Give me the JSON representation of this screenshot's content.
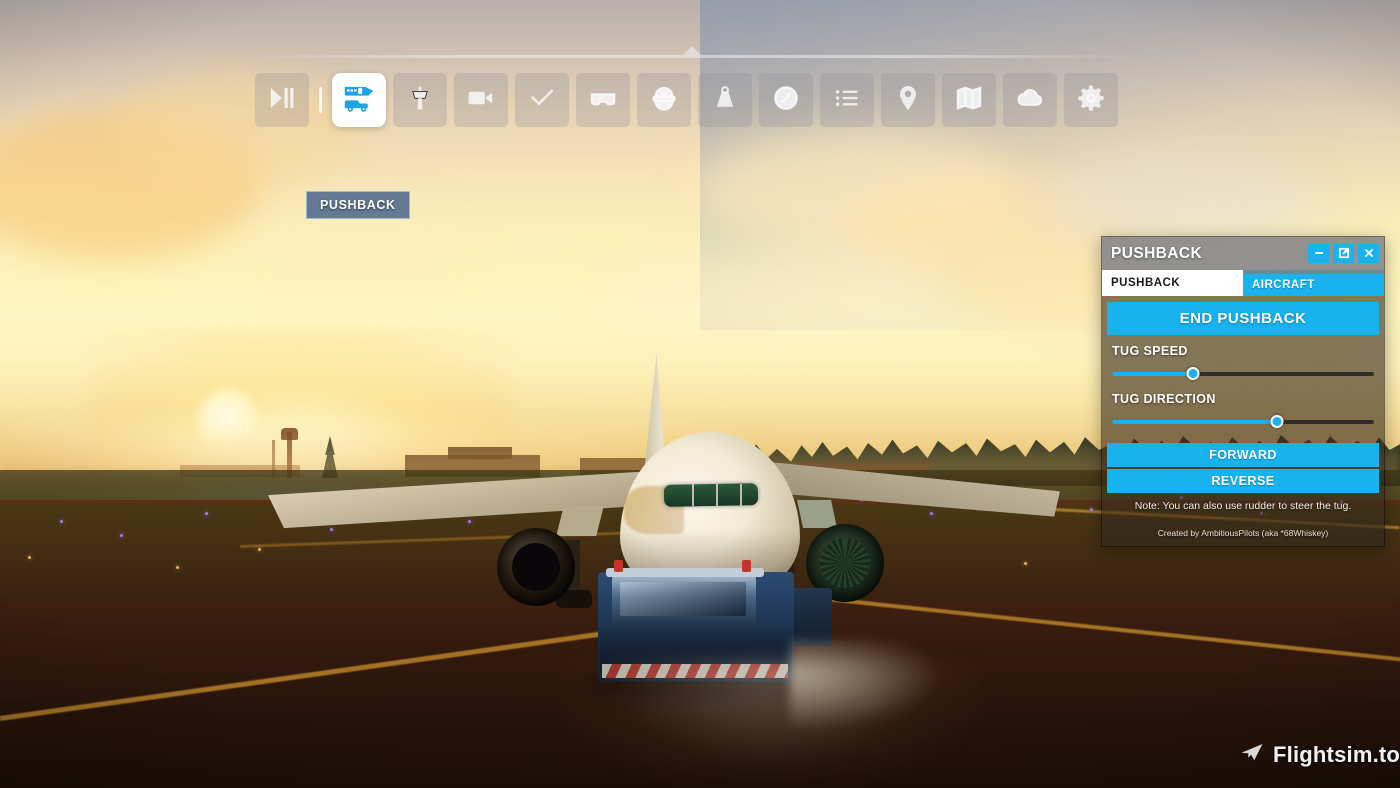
{
  "toolbar": {
    "chevron_icon": "chevron-up-icon",
    "items": [
      {
        "name": "sim-rate-play-pause",
        "icon": "play-pause-icon",
        "active": false
      },
      {
        "name": "pushback",
        "icon": "pushback-tug-aircraft-icon",
        "active": true
      },
      {
        "name": "atc",
        "icon": "atc-tower-icon",
        "active": false
      },
      {
        "name": "camera",
        "icon": "video-camera-icon",
        "active": false
      },
      {
        "name": "checklist",
        "icon": "checkmark-icon",
        "active": false
      },
      {
        "name": "vr-cockpit",
        "icon": "vr-headset-icon",
        "active": false
      },
      {
        "name": "copilot",
        "icon": "pilot-cap-icon",
        "active": false
      },
      {
        "name": "weight-balance",
        "icon": "weight-icon",
        "active": false
      },
      {
        "name": "navlog",
        "icon": "compass-icon",
        "active": false
      },
      {
        "name": "objectives",
        "icon": "list-icon",
        "active": false
      },
      {
        "name": "nearest-airport",
        "icon": "map-pin-icon",
        "active": false
      },
      {
        "name": "vfr-map",
        "icon": "folded-map-icon",
        "active": false
      },
      {
        "name": "weather",
        "icon": "cloud-icon",
        "active": false
      },
      {
        "name": "settings",
        "icon": "gear-icon",
        "active": false
      }
    ],
    "tooltip": "PUSHBACK"
  },
  "panel": {
    "title": "PUSHBACK",
    "window_controls": [
      {
        "name": "minimize",
        "icon": "minimize-icon",
        "glyph": "–"
      },
      {
        "name": "popout",
        "icon": "popout-window-icon",
        "glyph": "⧉"
      },
      {
        "name": "close",
        "icon": "close-icon",
        "glyph": "✕"
      }
    ],
    "tabs": [
      {
        "label": "PUSHBACK",
        "active": true
      },
      {
        "label": "AIRCRAFT",
        "active": false
      }
    ],
    "end_pushback_label": "END PUSHBACK",
    "sliders": [
      {
        "label": "TUG SPEED",
        "value_percent": 31
      },
      {
        "label": "TUG DIRECTION",
        "value_percent": 63
      }
    ],
    "forward_label": "FORWARD",
    "reverse_label": "REVERSE",
    "note": "Note: You can also use rudder to steer the tug.",
    "credit": "Created by AmbitiousPilots (aka *68Whiskey)",
    "accent_color": "#18b2ef",
    "header_color": "#848488",
    "active_tab_bg": "#ffffff"
  },
  "watermark": {
    "text": "Flightsim.to",
    "icon": "paper-plane-icon"
  },
  "scene": {
    "description": "Airbus A320 on airport apron at sunset with blue pushback tug attached to nose gear",
    "sky_colors": [
      "#b9b0ac",
      "#f2dfb6",
      "#fef6c2",
      "#d8a865"
    ],
    "ground_color": "#341a0d",
    "taxi_line_color": "#c48c2a"
  }
}
